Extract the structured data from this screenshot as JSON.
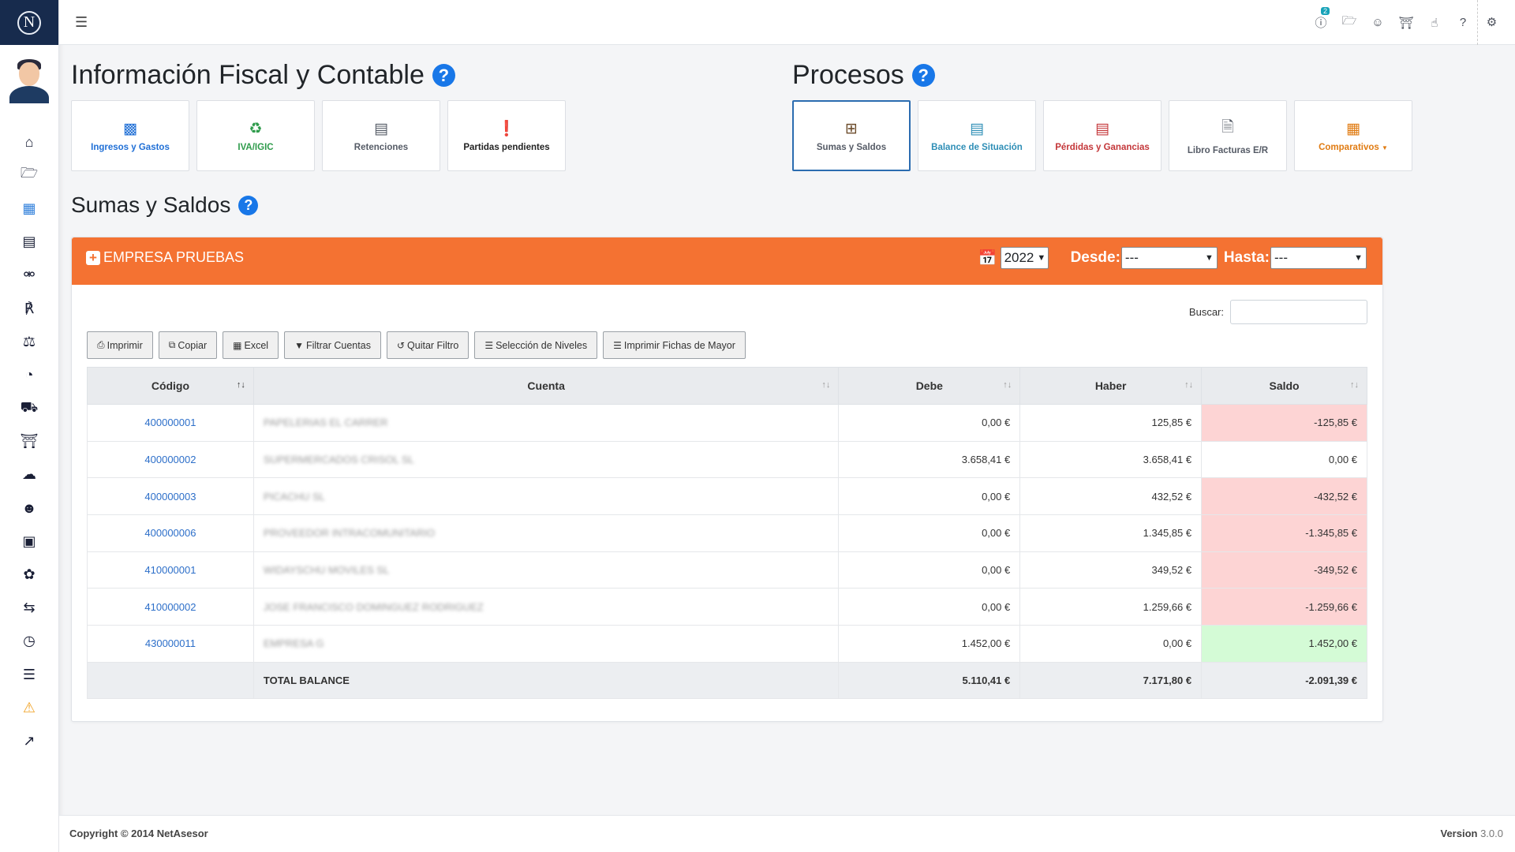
{
  "app": {
    "logo_letter": "N",
    "sidebar_icons": [
      "home-icon",
      "folder-open-icon",
      "calculator-icon",
      "address-book-icon",
      "handshake-icon",
      "rss-icon",
      "scale-icon",
      "dashboard-icon",
      "truck-icon",
      "bank-icon",
      "comments-icon",
      "users-icon",
      "money-icon",
      "leaf-icon",
      "retweet-icon",
      "clock-icon",
      "server-icon",
      "warning-icon",
      "external-link-icon"
    ],
    "top_badge": "2"
  },
  "fiscal": {
    "title": "Información Fiscal y Contable",
    "tiles": [
      {
        "label": "Ingresos y Gastos",
        "icon": "bar-chart-icon"
      },
      {
        "label": "IVA/IGIC",
        "icon": "recycle-icon"
      },
      {
        "label": "Retenciones",
        "icon": "newspaper-icon"
      },
      {
        "label": "Partidas pendientes",
        "icon": "exclamation-icon"
      }
    ]
  },
  "procesos": {
    "title": "Procesos",
    "tiles": [
      {
        "label": "Sumas y Saldos",
        "icon": "plus-square-icon"
      },
      {
        "label": "Balance de Situación",
        "icon": "newspaper-icon"
      },
      {
        "label": "Pérdidas y Ganancias",
        "icon": "newspaper-icon"
      },
      {
        "label": "Libro Facturas E/R",
        "icon": "file-icon"
      },
      {
        "label": "Comparativos",
        "icon": "table-icon"
      }
    ]
  },
  "report": {
    "title": "Sumas y Saldos",
    "company": "EMPRESA PRUEBAS",
    "year": "2022",
    "desde_label": "Desde:",
    "desde_value": "---",
    "hasta_label": "Hasta:",
    "hasta_value": "---",
    "search_label": "Buscar:",
    "buttons": [
      "Imprimir",
      "Copiar",
      "Excel",
      "Filtrar Cuentas",
      "Quitar Filtro",
      "Selección de Niveles",
      "Imprimir Fichas de Mayor"
    ],
    "columns": [
      "Código",
      "Cuenta",
      "Debe",
      "Haber",
      "Saldo"
    ],
    "rows": [
      {
        "codigo": "400000001",
        "cuenta": "PAPELERIAS EL CARRER",
        "debe": "0,00 €",
        "haber": "125,85 €",
        "saldo": "-125,85 €",
        "status": "neg"
      },
      {
        "codigo": "400000002",
        "cuenta": "SUPERMERCADOS CRISOL SL",
        "debe": "3.658,41 €",
        "haber": "3.658,41 €",
        "saldo": "0,00 €",
        "status": "zero"
      },
      {
        "codigo": "400000003",
        "cuenta": "PICACHU SL",
        "debe": "0,00 €",
        "haber": "432,52 €",
        "saldo": "-432,52 €",
        "status": "neg"
      },
      {
        "codigo": "400000006",
        "cuenta": "PROVEEDOR INTRACOMUNITARIO",
        "debe": "0,00 €",
        "haber": "1.345,85 €",
        "saldo": "-1.345,85 €",
        "status": "neg"
      },
      {
        "codigo": "410000001",
        "cuenta": "WIDAYSCHU MOVILES SL",
        "debe": "0,00 €",
        "haber": "349,52 €",
        "saldo": "-349,52 €",
        "status": "neg"
      },
      {
        "codigo": "410000002",
        "cuenta": "JOSE FRANCISCO DOMINGUEZ RODRIGUEZ",
        "debe": "0,00 €",
        "haber": "1.259,66 €",
        "saldo": "-1.259,66 €",
        "status": "neg"
      },
      {
        "codigo": "430000011",
        "cuenta": "EMPRESA G",
        "debe": "1.452,00 €",
        "haber": "0,00 €",
        "saldo": "1.452,00 €",
        "status": "pos"
      }
    ],
    "total": {
      "label": "TOTAL BALANCE",
      "debe": "5.110,41 €",
      "haber": "7.171,80 €",
      "saldo": "-2.091,39 €"
    }
  },
  "footer": {
    "copyright": "Copyright © 2014 NetAsesor",
    "version_label": "Version",
    "version": "3.0.0"
  },
  "colors": {
    "accent_orange": "#f47232",
    "navy": "#172b4d",
    "link_blue": "#2d6fc9",
    "negative_bg": "#fdd4d4",
    "positive_bg": "#d4fbd6"
  }
}
